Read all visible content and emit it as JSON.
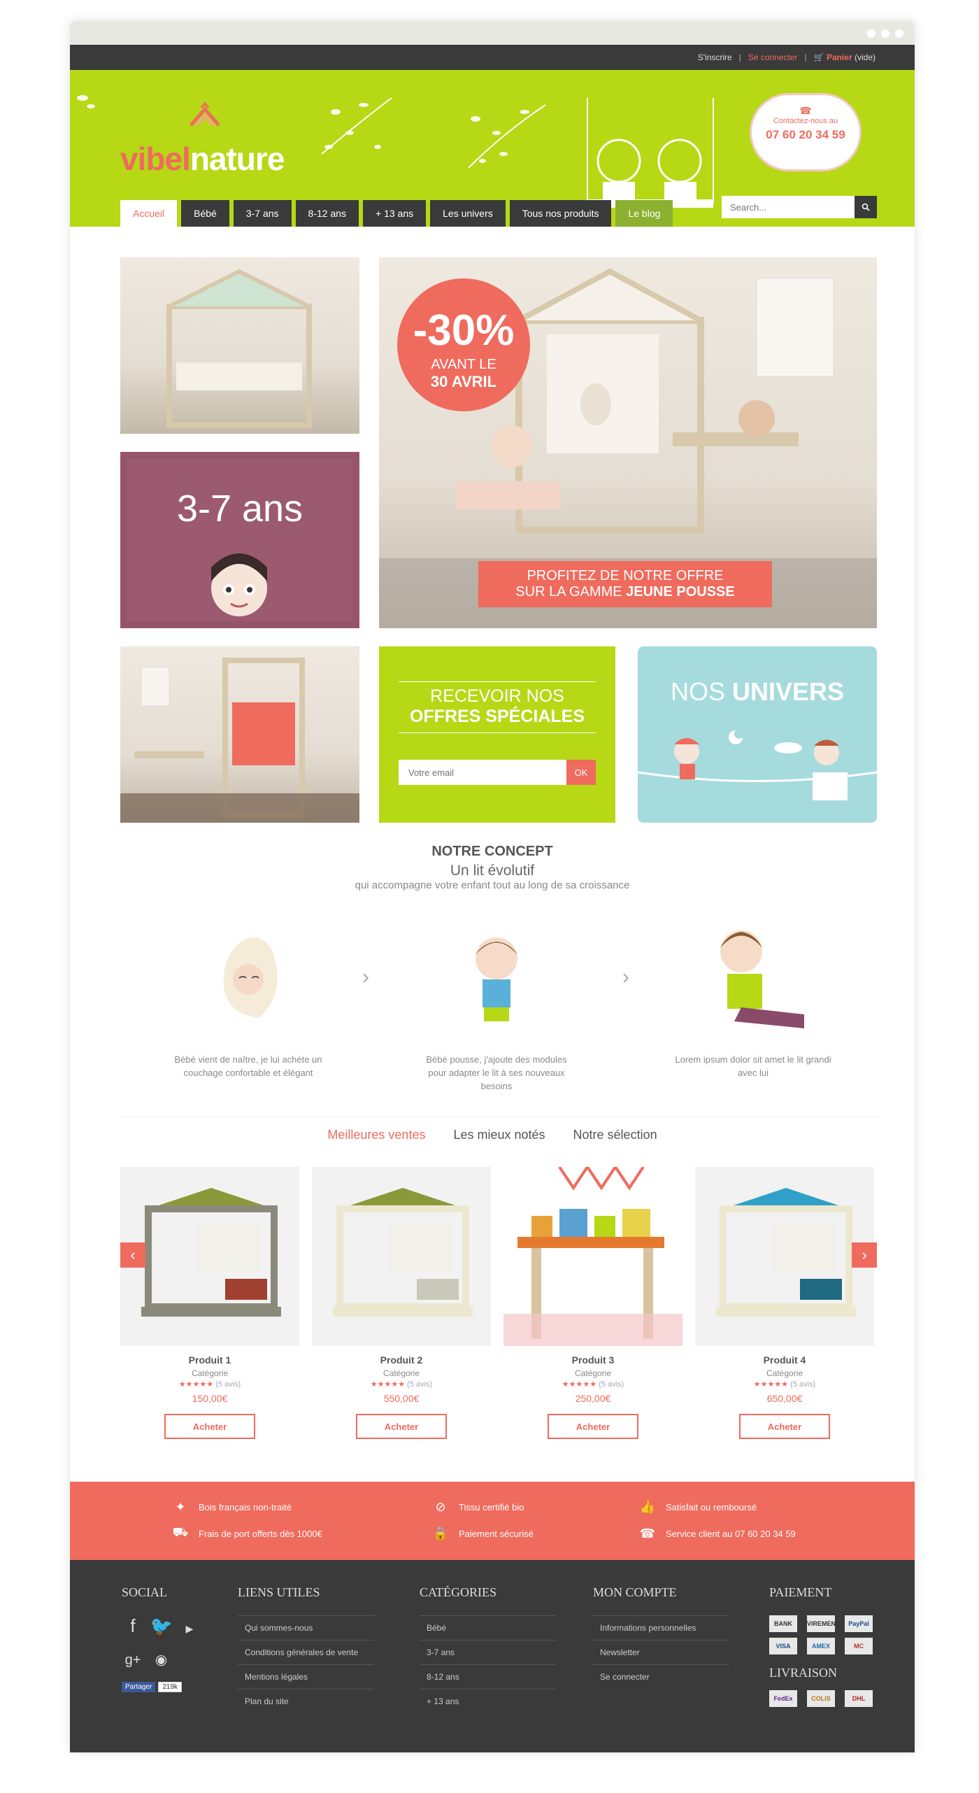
{
  "topbar": {
    "signup": "S'inscrire",
    "sep": "|",
    "login": "Se connecter",
    "cart_label": "Panier",
    "cart_state": "(vide)"
  },
  "brand": {
    "logo_part1": "vibel",
    "logo_part2": "nature",
    "phone_label": "Contactez-nous au",
    "phone_number": "07 60 20 34 59"
  },
  "nav": {
    "tabs": [
      "Accueil",
      "Bébé",
      "3-7 ans",
      "8-12 ans",
      "+ 13 ans",
      "Les univers",
      "Tous nos produits",
      "Le blog"
    ],
    "search_placeholder": "Search..."
  },
  "hero": {
    "age_card": "3-7 ans",
    "badge_pct": "-30%",
    "badge_line1": "AVANT LE",
    "badge_line2": "30 AVRIL",
    "ribbon_line1": "PROFITEZ DE NOTRE OFFRE",
    "ribbon_line2a": "SUR LA GAMME",
    "ribbon_line2b": "JEUNE POUSSE"
  },
  "newsletter": {
    "line1": "RECEVOIR NOS",
    "line2": "OFFRES SPÉCIALES",
    "placeholder": "Votre email",
    "ok": "OK"
  },
  "univers": {
    "part1": "NOS",
    "part2": "UNIVERS"
  },
  "concept": {
    "title": "NOTRE CONCEPT",
    "subtitle": "Un lit évolutif",
    "tagline": "qui accompagne votre enfant tout au long de sa croissance",
    "steps": [
      "Bébé vient de naître, je lui achète un couchage confortable et élégant",
      "Bébé pousse, j'ajoute des modules pour adapter le lit à ses nouveaux besoins",
      "Lorem ipsum dolor sit amet le lit grandi avec lui"
    ]
  },
  "product_tabs": [
    "Meilleures ventes",
    "Les mieux notés",
    "Notre sélection"
  ],
  "products": [
    {
      "name": "Produit 1",
      "category": "Catégorie",
      "stars": "★★★★★",
      "reviews": "(5 avis)",
      "price": "150,00€",
      "buy": "Acheter"
    },
    {
      "name": "Produit 2",
      "category": "Catégorie",
      "stars": "★★★★★",
      "reviews": "(5 avis)",
      "price": "550,00€",
      "buy": "Acheter"
    },
    {
      "name": "Produit 3",
      "category": "Catégorie",
      "stars": "★★★★★",
      "reviews": "(5 avis)",
      "price": "250,00€",
      "buy": "Acheter"
    },
    {
      "name": "Produit 4",
      "category": "Catégorie",
      "stars": "★★★★★",
      "reviews": "(5 avis)",
      "price": "650,00€",
      "buy": "Acheter"
    }
  ],
  "features": [
    "Bois français non-traité",
    "Tissu certifié bio",
    "Satisfait ou remboursé",
    "Frais de port offerts dès 1000€",
    "Paiement sécurisé",
    "Service client au 07 60 20 34 59"
  ],
  "footer": {
    "social_title": "SOCIAL",
    "share_label": "Partager",
    "share_count": "219k",
    "links_title": "LIENS UTILES",
    "links": [
      "Qui sommes-nous",
      "Conditions générales de vente",
      "Mentions légales",
      "Plan du site"
    ],
    "cat_title": "CATÉGORIES",
    "cats": [
      "Bébé",
      "3-7 ans",
      "8-12 ans",
      "+ 13 ans"
    ],
    "account_title": "MON COMPTE",
    "account": [
      "Informations personnelles",
      "Newsletter",
      "Se connecter"
    ],
    "payment_title": "PAIEMENT",
    "payments": [
      "BANK",
      "VIREMENT",
      "PayPal",
      "VISA",
      "AMEX",
      "MC"
    ],
    "delivery_title": "LIVRAISON",
    "deliveries": [
      "FedEx",
      "COLIS",
      "DHL"
    ]
  },
  "colors": {
    "green": "#b6d815",
    "coral": "#ef6b5d",
    "dark": "#3a3a3a",
    "plum": "#96546b",
    "sky": "#a6dbdd"
  }
}
